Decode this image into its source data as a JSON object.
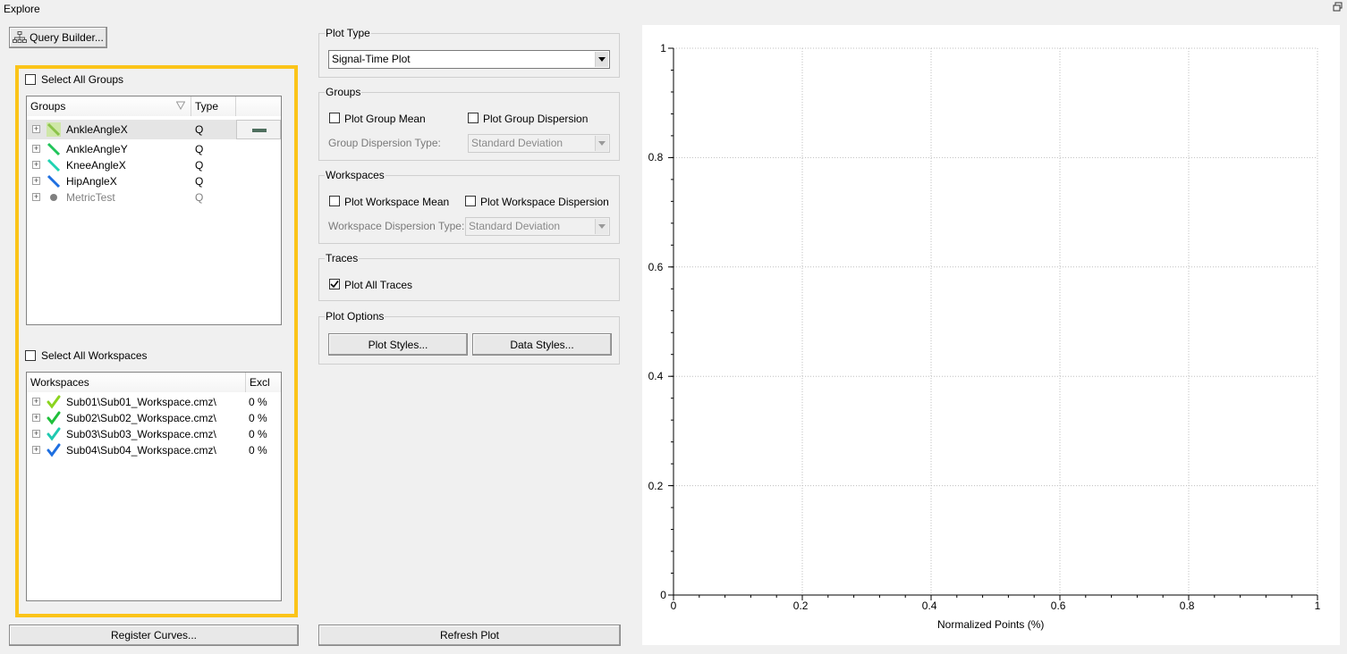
{
  "window": {
    "title": "Explore"
  },
  "toolbar": {
    "query_builder_label": "Query Builder..."
  },
  "groups_panel": {
    "select_all_label": "Select All Groups",
    "columns": {
      "name": "Groups",
      "type": "Type"
    },
    "rows": [
      {
        "name": "AnkleAngleX",
        "type": "Q",
        "color": "#8bc34a",
        "selected": true
      },
      {
        "name": "AnkleAngleY",
        "type": "Q",
        "color": "#21c45a"
      },
      {
        "name": "KneeAngleX",
        "type": "Q",
        "color": "#1fd3b1"
      },
      {
        "name": "HipAngleX",
        "type": "Q",
        "color": "#1e6fe0"
      },
      {
        "name": "MetricTest",
        "type": "Q",
        "color": "#808080",
        "disabled": true
      }
    ]
  },
  "workspaces_panel": {
    "select_all_label": "Select All Workspaces",
    "columns": {
      "name": "Workspaces",
      "excl": "Excl"
    },
    "rows": [
      {
        "name": "Sub01\\Sub01_Workspace.cmz\\",
        "excl": "0 %",
        "color": "#8bd41e"
      },
      {
        "name": "Sub02\\Sub02_Workspace.cmz\\",
        "excl": "0 %",
        "color": "#1fbf3a"
      },
      {
        "name": "Sub03\\Sub03_Workspace.cmz\\",
        "excl": "0 %",
        "color": "#1fc9b0"
      },
      {
        "name": "Sub04\\Sub04_Workspace.cmz\\",
        "excl": "0 %",
        "color": "#1e6fe0"
      }
    ]
  },
  "register_curves_label": "Register Curves...",
  "plot_type": {
    "title": "Plot Type",
    "value": "Signal-Time Plot"
  },
  "groups_box": {
    "title": "Groups",
    "plot_group_mean": "Plot Group Mean",
    "plot_group_dispersion": "Plot Group Dispersion",
    "dispersion_type_label": "Group Dispersion Type:",
    "dispersion_type_value": "Standard Deviation"
  },
  "workspaces_box": {
    "title": "Workspaces",
    "plot_workspace_mean": "Plot Workspace Mean",
    "plot_workspace_dispersion": "Plot Workspace Dispersion",
    "dispersion_type_label": "Workspace Dispersion Type:",
    "dispersion_type_value": "Standard Deviation"
  },
  "traces_box": {
    "title": "Traces",
    "plot_all_traces": "Plot All Traces",
    "plot_all_traces_checked": true
  },
  "plot_options_box": {
    "title": "Plot Options",
    "plot_styles_label": "Plot Styles...",
    "data_styles_label": "Data Styles..."
  },
  "refresh_plot_label": "Refresh Plot",
  "chart_data": {
    "type": "line",
    "title": "",
    "xlabel": "Normalized Points (%)",
    "ylabel": "",
    "xlim": [
      0,
      1
    ],
    "ylim": [
      0,
      1
    ],
    "x_ticks": [
      "0",
      "0.2",
      "0.4",
      "0.6",
      "0.8",
      "1"
    ],
    "y_ticks": [
      "0",
      "0.2",
      "0.4",
      "0.6",
      "0.8",
      "1"
    ],
    "grid": true,
    "series": []
  }
}
